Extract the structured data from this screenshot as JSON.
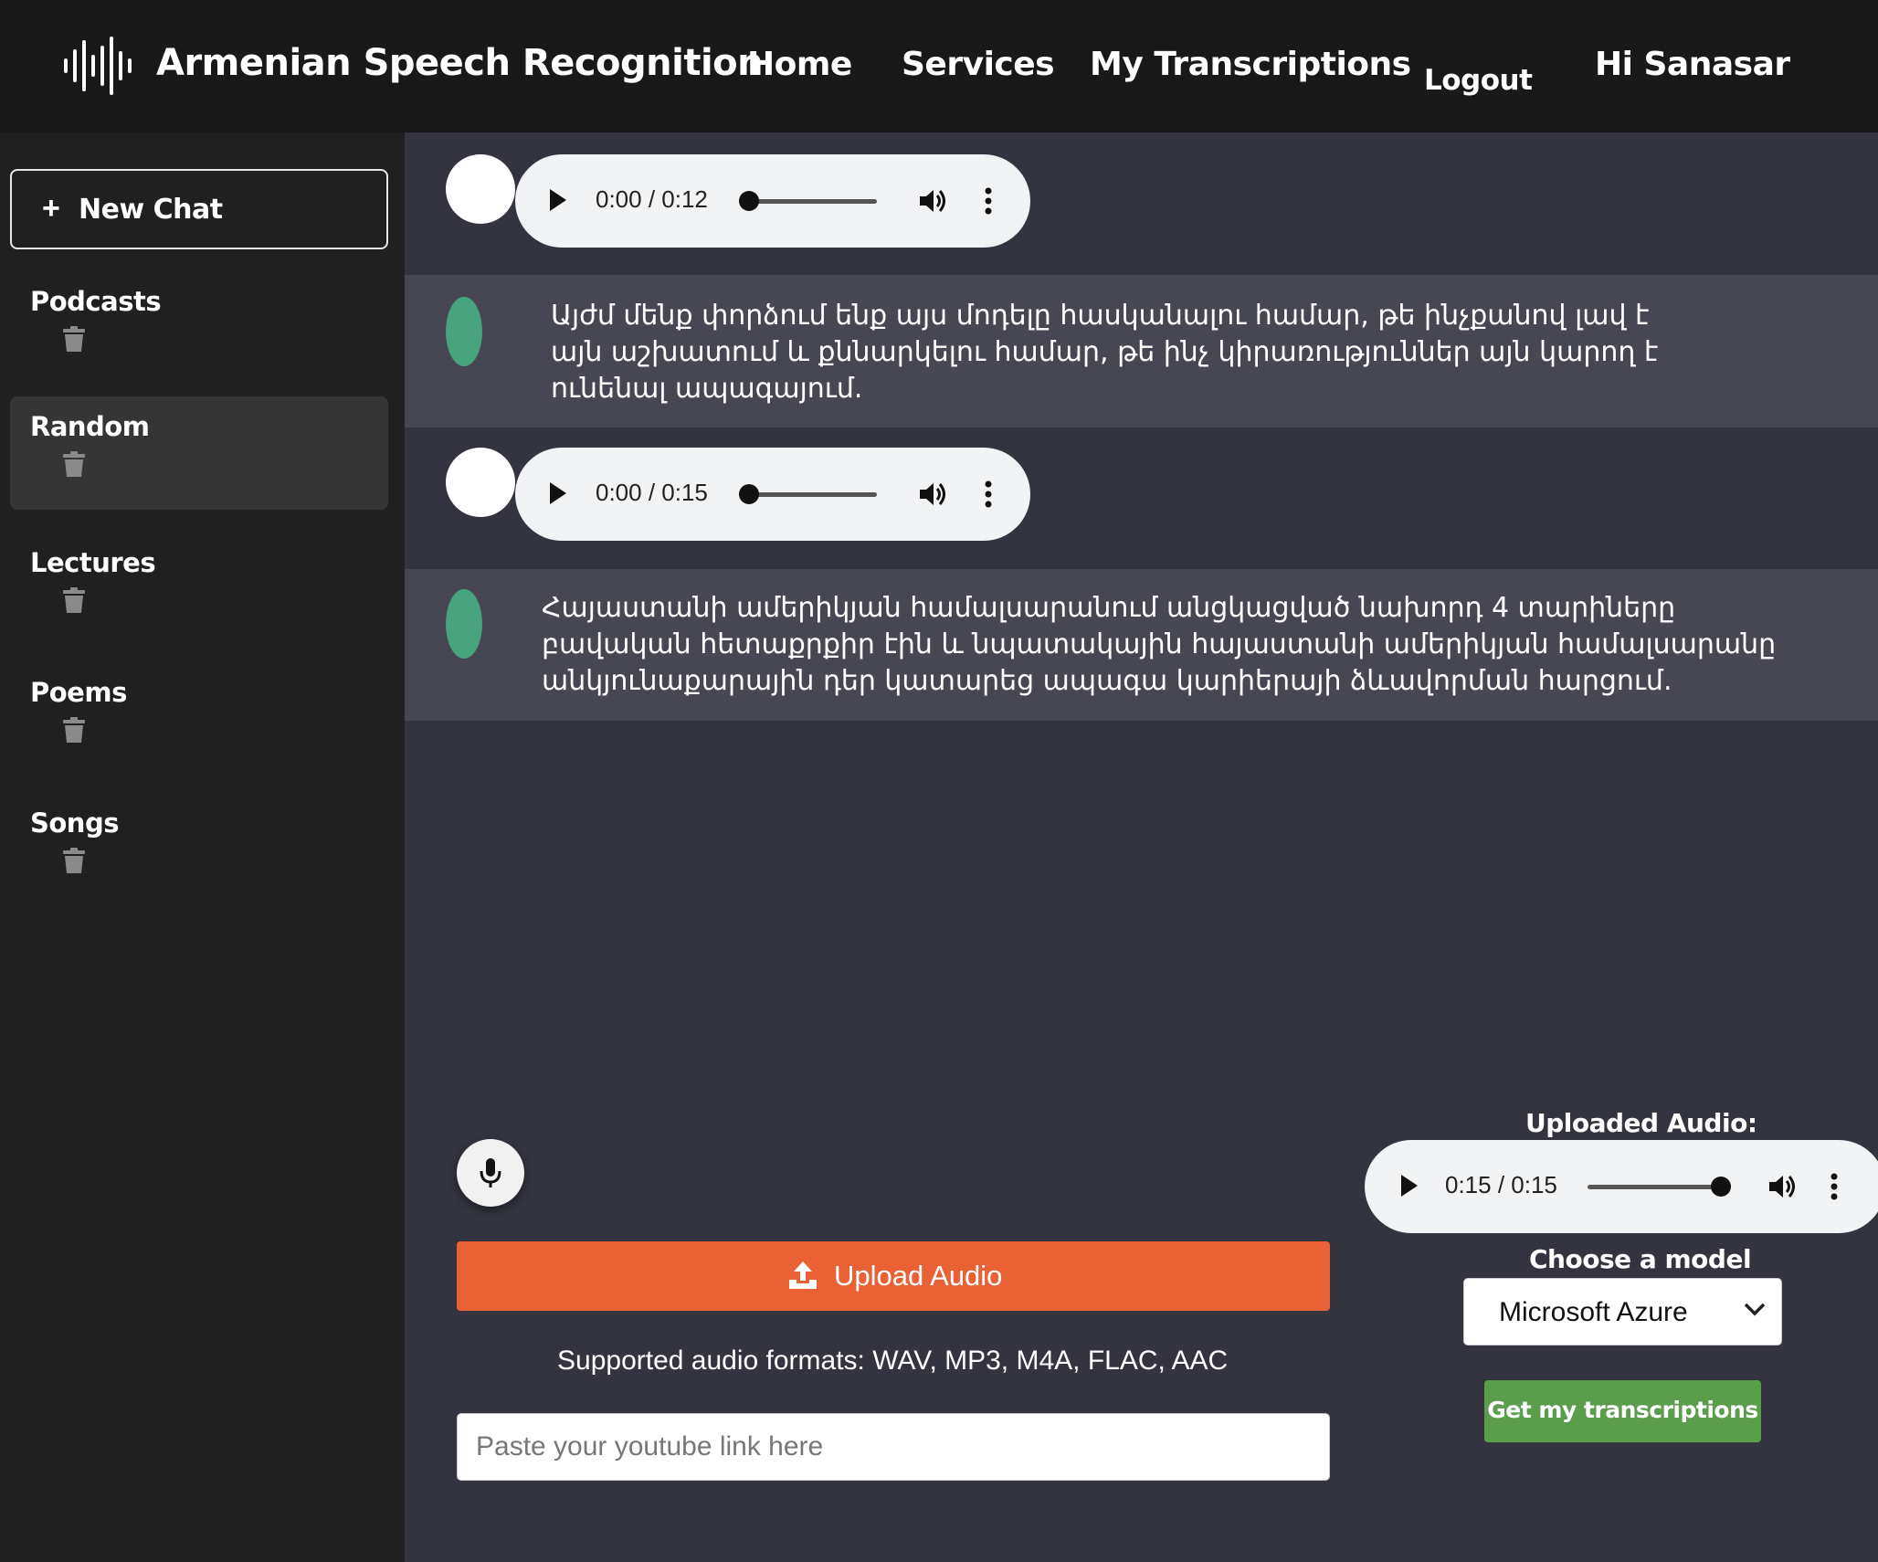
{
  "header": {
    "brand": "Armenian Speech Recognition",
    "logo_icon": "waveform-icon",
    "nav": {
      "home": "Home",
      "services": "Services",
      "my_transcriptions": "My Transcriptions",
      "logout": "Logout",
      "greeting": "Hi Sanasar"
    }
  },
  "sidebar": {
    "new_chat": {
      "plus": "+",
      "label": "New Chat"
    },
    "chats": [
      {
        "label": "Podcasts",
        "active": false
      },
      {
        "label": "Random",
        "active": true
      },
      {
        "label": "Lectures",
        "active": false
      },
      {
        "label": "Poems",
        "active": false
      },
      {
        "label": "Songs",
        "active": false
      }
    ]
  },
  "messages": [
    {
      "audio": {
        "time": "0:00 / 0:12",
        "progress": 0
      },
      "text": "Այժմ մենք փորձում ենք այս մոդելը հասկանալու համար, թե ինչքանով լավ է այն աշխատում և քննարկելու համար, թե ինչ կիրառություններ այն կարող է ունենալ ապագայում."
    },
    {
      "audio": {
        "time": "0:00 / 0:15",
        "progress": 0
      },
      "text": "Հայաստանի ամերիկյան համալսարանում անցկացված նախորդ 4 տարիները բավական հետաքրքիր էին և նպատակային հայաստանի ամերիկյան համալսարանը անկյունաքարային դեր կատարեց ապագա կարիերայի ձևավորման հարցում."
    }
  ],
  "controls": {
    "upload_label": "Upload Audio",
    "formats": "Supported audio formats: WAV, MP3, M4A, FLAC, AAC",
    "youtube_placeholder": "Paste your youtube link here",
    "uploaded_label": "Uploaded Audio:",
    "uploaded_audio": {
      "time": "0:15 / 0:15",
      "progress": 1
    },
    "model_label": "Choose a model",
    "model_value": "Microsoft Azure",
    "get_button": "Get my transcriptions"
  },
  "colors": {
    "header_bg": "#191919",
    "sidebar_bg": "#202021",
    "main_bg": "#33343f",
    "text_row_bg": "#464752",
    "upload_orange": "#ea6136",
    "get_green": "#5a9e4c",
    "avatar_green": "#4aa37f"
  }
}
